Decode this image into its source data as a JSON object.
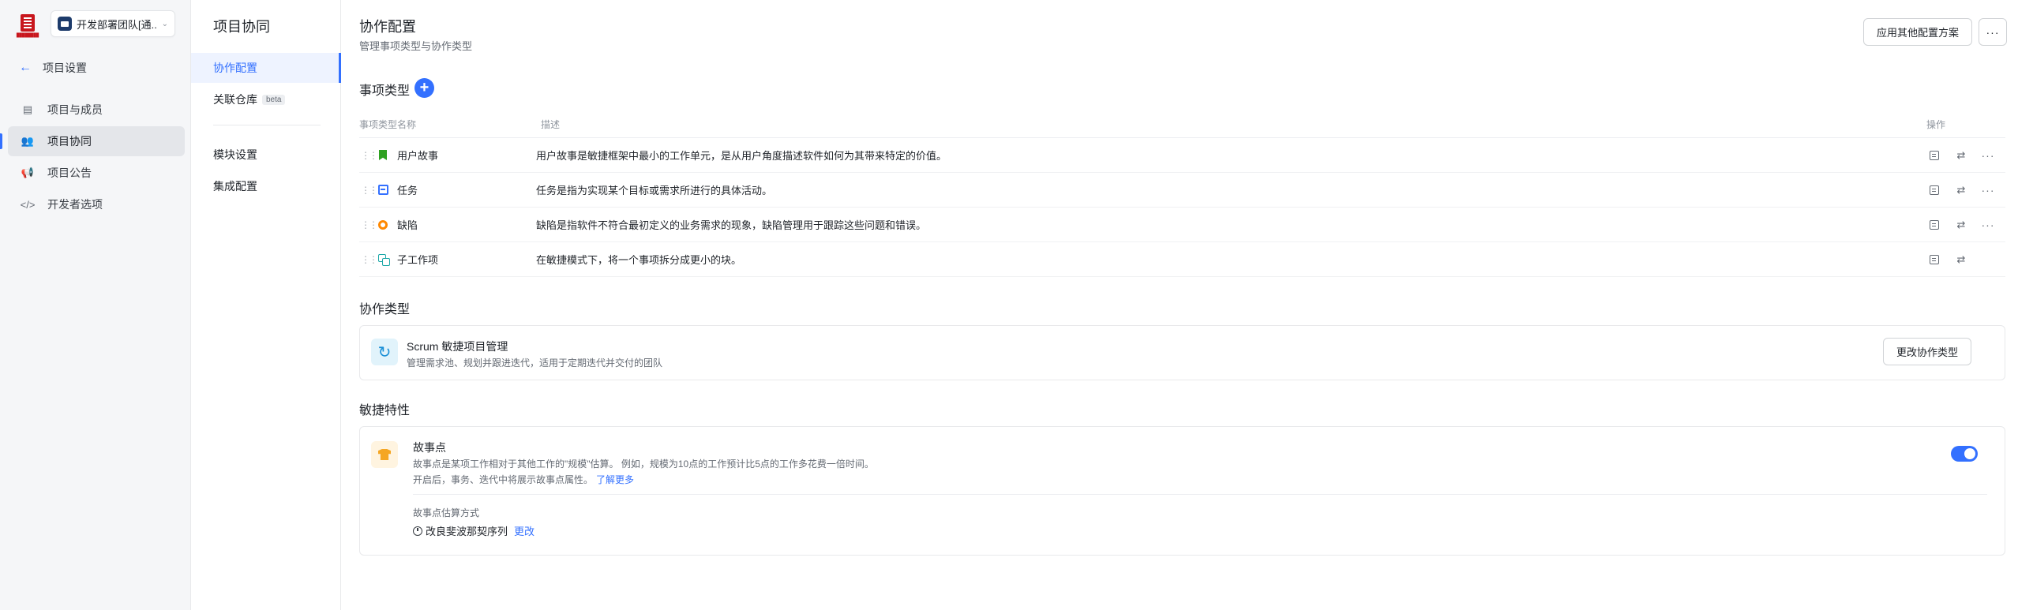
{
  "sidebar": {
    "logo_text": "████████",
    "team_name": "开发部署团队[通...",
    "back_label": "项目设置",
    "items": [
      {
        "label": "项目与成员",
        "icon": "members-icon"
      },
      {
        "label": "项目协同",
        "icon": "collab-icon",
        "active": true
      },
      {
        "label": "项目公告",
        "icon": "announcement-icon"
      },
      {
        "label": "开发者选项",
        "icon": "code-icon"
      }
    ]
  },
  "subnav": {
    "title": "项目协同",
    "items": [
      {
        "label": "协作配置",
        "active": true
      },
      {
        "label": "关联仓库",
        "badge": "beta"
      },
      {
        "label": "模块设置"
      },
      {
        "label": "集成配置"
      }
    ]
  },
  "header": {
    "title": "协作配置",
    "subtitle": "管理事项类型与协作类型",
    "apply_button": "应用其他配置方案",
    "more_button": "···"
  },
  "issue_types": {
    "section_title": "事项类型",
    "columns": [
      "事项类型名称",
      "描述",
      "操作"
    ],
    "rows": [
      {
        "name": "用户故事",
        "icon": "story-icon",
        "description": "用户故事是敏捷框架中最小的工作单元，是从用户角度描述软件如何为其带来特定的价值。",
        "has_more": true
      },
      {
        "name": "任务",
        "icon": "task-icon",
        "description": "任务是指为实现某个目标或需求所进行的具体活动。",
        "has_more": true
      },
      {
        "name": "缺陷",
        "icon": "bug-icon",
        "description": "缺陷是指软件不符合最初定义的业务需求的现象，缺陷管理用于跟踪这些问题和错误。",
        "has_more": true
      },
      {
        "name": "子工作项",
        "icon": "subtask-icon",
        "description": "在敏捷模式下，将一个事项拆分成更小的块。",
        "has_more": false
      }
    ]
  },
  "collab_type": {
    "section_title": "协作类型",
    "title": "Scrum 敏捷项目管理",
    "description": "管理需求池、规划并跟进迭代，适用于定期迭代并交付的团队",
    "change_button": "更改协作类型"
  },
  "agile": {
    "section_title": "敏捷特性",
    "title": "故事点",
    "desc1": "故事点是某项工作相对于其他工作的\"规模\"估算。 例如，规模为10点的工作预计比5点的工作多花费一倍时间。",
    "desc2": "开启后，事务、迭代中将展示故事点属性。",
    "learn_more": "了解更多",
    "enabled": true,
    "estimation_label": "故事点估算方式",
    "estimation_value": "改良斐波那契序列",
    "change_link": "更改"
  }
}
